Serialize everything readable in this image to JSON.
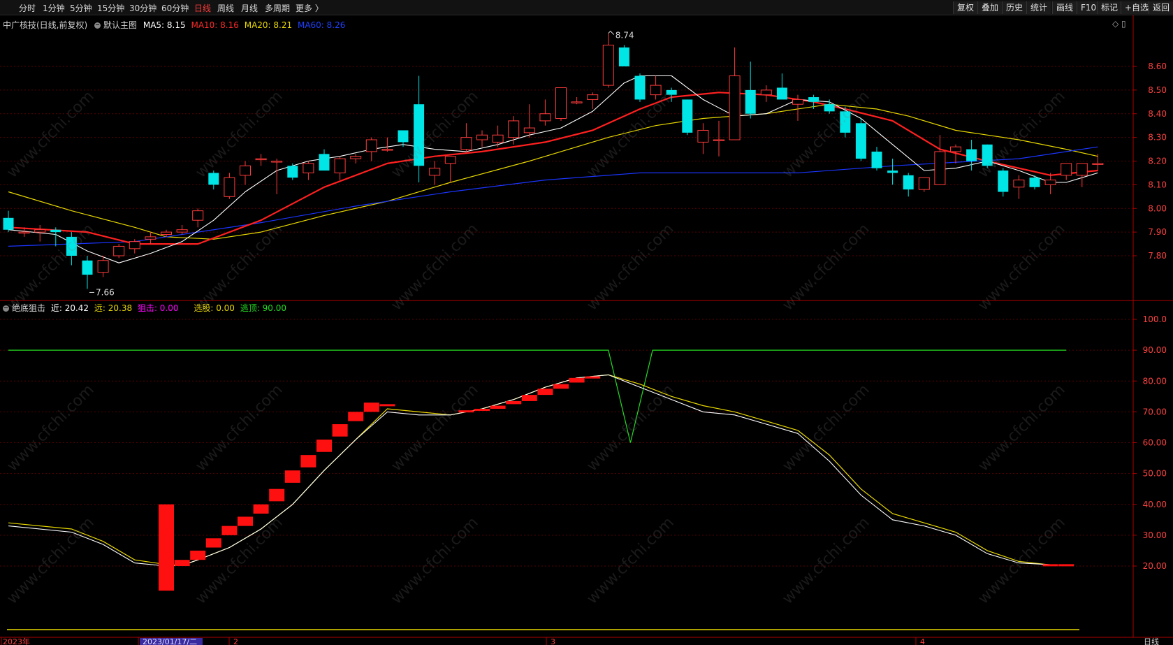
{
  "toolbar": {
    "periods": [
      "分时",
      "1分钟",
      "5分钟",
      "15分钟",
      "30分钟",
      "60分钟",
      "日线",
      "周线",
      "月线",
      "多周期",
      "更多 〉"
    ],
    "active_period": "日线",
    "right_buttons": [
      "复权",
      "叠加",
      "历史",
      "统计",
      "画线",
      "F10",
      "标记",
      "+自选",
      "返回"
    ]
  },
  "main_chart": {
    "title": "中广核技(日线,前复权)",
    "template": "默认主图",
    "ma_labels": [
      {
        "text": "MA5: 8.15",
        "color": "#ffffff"
      },
      {
        "text": "MA10: 8.16",
        "color": "#ff2a2a"
      },
      {
        "text": "MA20: 8.21",
        "color": "#e8d800"
      },
      {
        "text": "MA60: 8.26",
        "color": "#2040ff"
      }
    ],
    "high_label": "8.74",
    "low_label": "7.66",
    "y_ticks": [
      "8.60",
      "8.50",
      "8.40",
      "8.30",
      "8.20",
      "8.10",
      "8.00",
      "7.90",
      "7.80"
    ]
  },
  "indicator": {
    "name": "绝底狙击",
    "labels": [
      {
        "text": "近: 20.42",
        "color": "#ffffff"
      },
      {
        "text": "远: 20.38",
        "color": "#e8d800"
      },
      {
        "text": "狙击: 0.00",
        "color": "#ff00ff"
      },
      {
        "text": "选股: 0.00",
        "color": "#e8d800"
      },
      {
        "text": "逃顶: 90.00",
        "color": "#22dd22"
      }
    ],
    "y_ticks": [
      "100.0",
      "90.00",
      "80.00",
      "70.00",
      "60.00",
      "50.00",
      "40.00",
      "30.00",
      "20.00"
    ]
  },
  "x_axis": {
    "labels": [
      "2023年",
      "2023/01/17/二",
      "2",
      "3",
      "4"
    ],
    "period_tag": "日线"
  },
  "watermark": "www.cfchi.com",
  "colors": {
    "up": "#ff3b3b",
    "down": "#00e5e5",
    "ma5": "#ffffff",
    "ma10": "#ff2020",
    "ma20": "#e8d800",
    "ma60": "#1a35ff",
    "grid": "#5a0000",
    "axis": "#b00000"
  },
  "chart_data": {
    "type": "candlestick",
    "candles": [
      {
        "o": 7.96,
        "h": 7.99,
        "l": 7.9,
        "c": 7.91
      },
      {
        "o": 7.9,
        "h": 7.92,
        "l": 7.88,
        "c": 7.9
      },
      {
        "o": 7.9,
        "h": 7.93,
        "l": 7.86,
        "c": 7.91
      },
      {
        "o": 7.91,
        "h": 7.92,
        "l": 7.84,
        "c": 7.9
      },
      {
        "o": 7.88,
        "h": 7.9,
        "l": 7.76,
        "c": 7.8
      },
      {
        "o": 7.78,
        "h": 7.8,
        "l": 7.66,
        "c": 7.72
      },
      {
        "o": 7.73,
        "h": 7.8,
        "l": 7.71,
        "c": 7.78
      },
      {
        "o": 7.8,
        "h": 7.85,
        "l": 7.79,
        "c": 7.84
      },
      {
        "o": 7.83,
        "h": 7.87,
        "l": 7.81,
        "c": 7.86
      },
      {
        "o": 7.87,
        "h": 7.9,
        "l": 7.85,
        "c": 7.88
      },
      {
        "o": 7.89,
        "h": 7.91,
        "l": 7.88,
        "c": 7.9
      },
      {
        "o": 7.9,
        "h": 7.93,
        "l": 7.89,
        "c": 7.91
      },
      {
        "o": 7.95,
        "h": 8.0,
        "l": 7.92,
        "c": 7.99
      },
      {
        "o": 8.15,
        "h": 8.16,
        "l": 8.08,
        "c": 8.1
      },
      {
        "o": 8.05,
        "h": 8.15,
        "l": 8.04,
        "c": 8.13
      },
      {
        "o": 8.14,
        "h": 8.2,
        "l": 8.1,
        "c": 8.18
      },
      {
        "o": 8.21,
        "h": 8.23,
        "l": 8.18,
        "c": 8.21
      },
      {
        "o": 8.2,
        "h": 8.21,
        "l": 8.06,
        "c": 8.2
      },
      {
        "o": 8.18,
        "h": 8.19,
        "l": 8.12,
        "c": 8.13
      },
      {
        "o": 8.15,
        "h": 8.2,
        "l": 8.12,
        "c": 8.19
      },
      {
        "o": 8.23,
        "h": 8.25,
        "l": 8.16,
        "c": 8.16
      },
      {
        "o": 8.15,
        "h": 8.22,
        "l": 8.12,
        "c": 8.21
      },
      {
        "o": 8.21,
        "h": 8.23,
        "l": 8.19,
        "c": 8.22
      },
      {
        "o": 8.24,
        "h": 8.3,
        "l": 8.2,
        "c": 8.29
      },
      {
        "o": 8.25,
        "h": 8.3,
        "l": 8.24,
        "c": 8.25
      },
      {
        "o": 8.33,
        "h": 8.33,
        "l": 8.26,
        "c": 8.28
      },
      {
        "o": 8.44,
        "h": 8.56,
        "l": 8.11,
        "c": 8.18
      },
      {
        "o": 8.14,
        "h": 8.2,
        "l": 8.1,
        "c": 8.17
      },
      {
        "o": 8.19,
        "h": 8.22,
        "l": 8.11,
        "c": 8.22
      },
      {
        "o": 8.25,
        "h": 8.36,
        "l": 8.24,
        "c": 8.3
      },
      {
        "o": 8.29,
        "h": 8.33,
        "l": 8.26,
        "c": 8.31
      },
      {
        "o": 8.28,
        "h": 8.35,
        "l": 8.26,
        "c": 8.31
      },
      {
        "o": 8.3,
        "h": 8.39,
        "l": 8.27,
        "c": 8.37
      },
      {
        "o": 8.32,
        "h": 8.44,
        "l": 8.3,
        "c": 8.34
      },
      {
        "o": 8.37,
        "h": 8.46,
        "l": 8.35,
        "c": 8.4
      },
      {
        "o": 8.38,
        "h": 8.51,
        "l": 8.37,
        "c": 8.51
      },
      {
        "o": 8.45,
        "h": 8.47,
        "l": 8.44,
        "c": 8.45
      },
      {
        "o": 8.46,
        "h": 8.49,
        "l": 8.42,
        "c": 8.48
      },
      {
        "o": 8.52,
        "h": 8.74,
        "l": 8.51,
        "c": 8.69
      },
      {
        "o": 8.68,
        "h": 8.69,
        "l": 8.6,
        "c": 8.6
      },
      {
        "o": 8.56,
        "h": 8.57,
        "l": 8.45,
        "c": 8.46
      },
      {
        "o": 8.48,
        "h": 8.56,
        "l": 8.46,
        "c": 8.52
      },
      {
        "o": 8.5,
        "h": 8.51,
        "l": 8.45,
        "c": 8.48
      },
      {
        "o": 8.46,
        "h": 8.46,
        "l": 8.31,
        "c": 8.32
      },
      {
        "o": 8.28,
        "h": 8.36,
        "l": 8.23,
        "c": 8.33
      },
      {
        "o": 8.29,
        "h": 8.37,
        "l": 8.22,
        "c": 8.29
      },
      {
        "o": 8.29,
        "h": 8.68,
        "l": 8.29,
        "c": 8.56
      },
      {
        "o": 8.5,
        "h": 8.62,
        "l": 8.38,
        "c": 8.4
      },
      {
        "o": 8.48,
        "h": 8.52,
        "l": 8.45,
        "c": 8.5
      },
      {
        "o": 8.51,
        "h": 8.57,
        "l": 8.48,
        "c": 8.46
      },
      {
        "o": 8.44,
        "h": 8.48,
        "l": 8.37,
        "c": 8.46
      },
      {
        "o": 8.47,
        "h": 8.48,
        "l": 8.42,
        "c": 8.45
      },
      {
        "o": 8.44,
        "h": 8.46,
        "l": 8.4,
        "c": 8.41
      },
      {
        "o": 8.41,
        "h": 8.43,
        "l": 8.3,
        "c": 8.32
      },
      {
        "o": 8.36,
        "h": 8.38,
        "l": 8.2,
        "c": 8.21
      },
      {
        "o": 8.24,
        "h": 8.26,
        "l": 8.16,
        "c": 8.17
      },
      {
        "o": 8.16,
        "h": 8.21,
        "l": 8.1,
        "c": 8.15
      },
      {
        "o": 8.14,
        "h": 8.15,
        "l": 8.05,
        "c": 8.08
      },
      {
        "o": 8.08,
        "h": 8.13,
        "l": 8.07,
        "c": 8.13
      },
      {
        "o": 8.1,
        "h": 8.31,
        "l": 8.1,
        "c": 8.24
      },
      {
        "o": 8.24,
        "h": 8.27,
        "l": 8.19,
        "c": 8.26
      },
      {
        "o": 8.25,
        "h": 8.29,
        "l": 8.16,
        "c": 8.2
      },
      {
        "o": 8.27,
        "h": 8.27,
        "l": 8.17,
        "c": 8.18
      },
      {
        "o": 8.16,
        "h": 8.17,
        "l": 8.05,
        "c": 8.07
      },
      {
        "o": 8.09,
        "h": 8.14,
        "l": 8.04,
        "c": 8.12
      },
      {
        "o": 8.13,
        "h": 8.14,
        "l": 8.08,
        "c": 8.09
      },
      {
        "o": 8.1,
        "h": 8.15,
        "l": 8.06,
        "c": 8.12
      },
      {
        "o": 8.14,
        "h": 8.19,
        "l": 8.12,
        "c": 8.19
      },
      {
        "o": 8.14,
        "h": 8.19,
        "l": 8.09,
        "c": 8.19
      },
      {
        "o": 8.19,
        "h": 8.23,
        "l": 8.16,
        "c": 8.19
      }
    ],
    "ma_lines": {
      "MA20": [
        [
          0,
          8.07
        ],
        [
          4,
          7.99
        ],
        [
          8,
          7.92
        ],
        [
          10,
          7.88
        ],
        [
          13,
          7.87
        ],
        [
          16,
          7.9
        ],
        [
          20,
          7.97
        ],
        [
          24,
          8.03
        ],
        [
          28,
          8.11
        ],
        [
          33,
          8.2
        ],
        [
          38,
          8.3
        ],
        [
          41,
          8.35
        ],
        [
          44,
          8.38
        ],
        [
          48,
          8.4
        ],
        [
          52,
          8.44
        ],
        [
          55,
          8.42
        ],
        [
          57,
          8.39
        ],
        [
          60,
          8.33
        ],
        [
          64,
          8.29
        ],
        [
          67,
          8.25
        ],
        [
          69,
          8.22
        ]
      ],
      "MA60": [
        [
          0,
          7.84
        ],
        [
          8,
          7.86
        ],
        [
          16,
          7.94
        ],
        [
          22,
          8.01
        ],
        [
          28,
          8.07
        ],
        [
          34,
          8.12
        ],
        [
          40,
          8.15
        ],
        [
          50,
          8.15
        ],
        [
          56,
          8.18
        ],
        [
          64,
          8.21
        ],
        [
          69,
          8.26
        ]
      ],
      "MA10": [
        [
          0,
          7.92
        ],
        [
          5,
          7.9
        ],
        [
          8,
          7.85
        ],
        [
          12,
          7.85
        ],
        [
          16,
          7.95
        ],
        [
          20,
          8.09
        ],
        [
          24,
          8.19
        ],
        [
          27,
          8.22
        ],
        [
          30,
          8.24
        ],
        [
          34,
          8.28
        ],
        [
          37,
          8.33
        ],
        [
          40,
          8.42
        ],
        [
          42,
          8.47
        ],
        [
          45,
          8.49
        ],
        [
          48,
          8.48
        ],
        [
          51,
          8.45
        ],
        [
          53,
          8.42
        ],
        [
          56,
          8.37
        ],
        [
          59,
          8.25
        ],
        [
          62,
          8.2
        ],
        [
          64,
          8.17
        ],
        [
          66,
          8.14
        ],
        [
          69,
          8.16
        ]
      ],
      "MA5": [
        [
          0,
          7.91
        ],
        [
          3,
          7.89
        ],
        [
          5,
          7.82
        ],
        [
          7,
          7.77
        ],
        [
          9,
          7.81
        ],
        [
          11,
          7.86
        ],
        [
          13,
          7.95
        ],
        [
          15,
          8.07
        ],
        [
          17,
          8.16
        ],
        [
          19,
          8.2
        ],
        [
          21,
          8.22
        ],
        [
          23,
          8.25
        ],
        [
          25,
          8.27
        ],
        [
          27,
          8.25
        ],
        [
          29,
          8.24
        ],
        [
          31,
          8.27
        ],
        [
          33,
          8.31
        ],
        [
          35,
          8.34
        ],
        [
          37,
          8.41
        ],
        [
          39,
          8.53
        ],
        [
          40,
          8.56
        ],
        [
          42,
          8.56
        ],
        [
          44,
          8.46
        ],
        [
          46,
          8.39
        ],
        [
          48,
          8.4
        ],
        [
          50,
          8.46
        ],
        [
          52,
          8.45
        ],
        [
          54,
          8.38
        ],
        [
          56,
          8.27
        ],
        [
          58,
          8.16
        ],
        [
          60,
          8.17
        ],
        [
          62,
          8.2
        ],
        [
          64,
          8.16
        ],
        [
          66,
          8.11
        ],
        [
          67,
          8.11
        ],
        [
          69,
          8.15
        ]
      ]
    },
    "indicator_series": {
      "near": [
        [
          0,
          33
        ],
        [
          4,
          31
        ],
        [
          6,
          27
        ],
        [
          8,
          21
        ],
        [
          10,
          20
        ],
        [
          11,
          20.2
        ],
        [
          12,
          22
        ],
        [
          14,
          26
        ],
        [
          16,
          32
        ],
        [
          18,
          40
        ],
        [
          20,
          51
        ],
        [
          22,
          61
        ],
        [
          24,
          70
        ],
        [
          26,
          69
        ],
        [
          28,
          69
        ],
        [
          30,
          71
        ],
        [
          32,
          74
        ],
        [
          34,
          78
        ],
        [
          36,
          81
        ],
        [
          38,
          82
        ],
        [
          40,
          78
        ],
        [
          42,
          74
        ],
        [
          44,
          70
        ],
        [
          46,
          69
        ],
        [
          48,
          66
        ],
        [
          50,
          63
        ],
        [
          52,
          54
        ],
        [
          54,
          43
        ],
        [
          56,
          35
        ],
        [
          58,
          33
        ],
        [
          60,
          30
        ],
        [
          62,
          24
        ],
        [
          64,
          21
        ],
        [
          66,
          20.42
        ]
      ],
      "far": [
        [
          0,
          34
        ],
        [
          4,
          32
        ],
        [
          6,
          28
        ],
        [
          8,
          22
        ],
        [
          10,
          20.5
        ],
        [
          11,
          20.2
        ],
        [
          12,
          22
        ],
        [
          14,
          26
        ],
        [
          16,
          32
        ],
        [
          18,
          40
        ],
        [
          20,
          51
        ],
        [
          22,
          61
        ],
        [
          24,
          71
        ],
        [
          26,
          70
        ],
        [
          28,
          69
        ],
        [
          30,
          71
        ],
        [
          32,
          74
        ],
        [
          34,
          78
        ],
        [
          36,
          81
        ],
        [
          38,
          82
        ],
        [
          40,
          79
        ],
        [
          42,
          75
        ],
        [
          44,
          72
        ],
        [
          46,
          70
        ],
        [
          48,
          67
        ],
        [
          50,
          64
        ],
        [
          52,
          56
        ],
        [
          54,
          45
        ],
        [
          56,
          37
        ],
        [
          58,
          34
        ],
        [
          60,
          31
        ],
        [
          62,
          25
        ],
        [
          64,
          21.5
        ],
        [
          66,
          20.38
        ]
      ],
      "escape_top": [
        [
          0,
          90
        ],
        [
          38,
          90
        ],
        [
          39.4,
          60
        ],
        [
          40.8,
          90
        ],
        [
          67,
          90
        ]
      ],
      "snipe_bars": [
        [
          10,
          12,
          40
        ],
        [
          11,
          20,
          22
        ],
        [
          12,
          22,
          25
        ],
        [
          13,
          26,
          29
        ],
        [
          14,
          30,
          33
        ],
        [
          15,
          33,
          36
        ],
        [
          16,
          37,
          40
        ],
        [
          17,
          41,
          45
        ],
        [
          18,
          47,
          51
        ],
        [
          19,
          52,
          56
        ],
        [
          20,
          57,
          61
        ],
        [
          21,
          62,
          66
        ],
        [
          22,
          67,
          70
        ],
        [
          23,
          70,
          73
        ],
        [
          24,
          72,
          72.5
        ],
        [
          29,
          70,
          70.5
        ],
        [
          30,
          70.5,
          71
        ],
        [
          31,
          71,
          72
        ],
        [
          32,
          72.5,
          73.5
        ],
        [
          33,
          73.5,
          75.5
        ],
        [
          34,
          75.5,
          77.5
        ],
        [
          35,
          77.5,
          79
        ],
        [
          36,
          79.5,
          81
        ],
        [
          37,
          81,
          81.5
        ],
        [
          66,
          20.3,
          20.6
        ],
        [
          67,
          20.3,
          20.6
        ]
      ],
      "select_line": 0
    }
  }
}
